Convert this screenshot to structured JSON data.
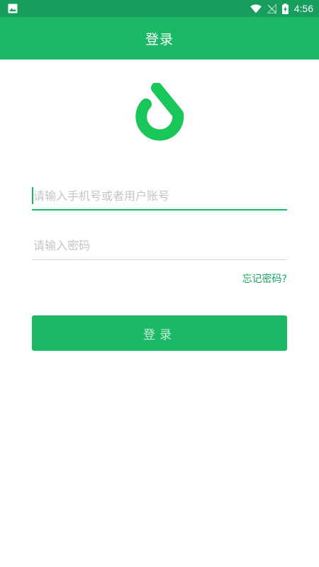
{
  "status_bar": {
    "time": "4:56",
    "icons": [
      "image-icon",
      "wifi-icon",
      "no-signal-icon",
      "battery-charging-icon"
    ]
  },
  "app_bar": {
    "title": "登录"
  },
  "logo": {
    "icon": "water-drop-logo-icon",
    "color": "#19c65a"
  },
  "form": {
    "username": {
      "value": "",
      "placeholder": "请输入手机号或者用户账号"
    },
    "password": {
      "value": "",
      "placeholder": "请输入密码"
    },
    "forgot_password": "忘记密码?",
    "login_button": "登录"
  },
  "colors": {
    "status_bar": "#189e5c",
    "app_bar": "#1bb865",
    "accent": "#1bb865",
    "link": "#1aa55d"
  }
}
